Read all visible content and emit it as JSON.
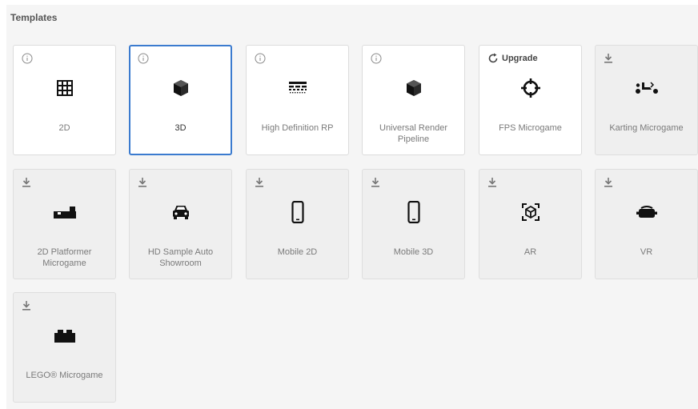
{
  "section_title": "Templates",
  "upgrade_label": "Upgrade",
  "colors": {
    "selected_border": "#3b7bcf",
    "panel_bg": "#f5f5f5"
  },
  "templates": [
    {
      "name": "2D",
      "badge": "info-icon",
      "icon": "grid-icon",
      "selected": false
    },
    {
      "name": "3D",
      "badge": "info-icon",
      "icon": "cube-icon",
      "selected": true
    },
    {
      "name": "High Definition RP",
      "badge": "info-icon",
      "icon": "hdrp-icon",
      "selected": false
    },
    {
      "name": "Universal Render Pipeline",
      "badge": "info-icon",
      "icon": "cube-icon",
      "selected": false
    },
    {
      "name": "FPS Microgame",
      "badge": "upgrade-icon",
      "icon": "crosshair-icon",
      "selected": false
    },
    {
      "name": "Karting Microgame",
      "badge": "download-icon",
      "icon": "kart-icon",
      "selected": false
    },
    {
      "name": "2D Platformer Microgame",
      "badge": "download-icon",
      "icon": "platformer-icon",
      "selected": false
    },
    {
      "name": "HD Sample Auto Showroom",
      "badge": "download-icon",
      "icon": "car-icon",
      "selected": false
    },
    {
      "name": "Mobile 2D",
      "badge": "download-icon",
      "icon": "phone-icon",
      "selected": false
    },
    {
      "name": "Mobile 3D",
      "badge": "download-icon",
      "icon": "phone-icon",
      "selected": false
    },
    {
      "name": "AR",
      "badge": "download-icon",
      "icon": "ar-icon",
      "selected": false
    },
    {
      "name": "VR",
      "badge": "download-icon",
      "icon": "vr-icon",
      "selected": false
    },
    {
      "name": "LEGO® Microgame",
      "badge": "download-icon",
      "icon": "lego-icon",
      "selected": false
    }
  ]
}
